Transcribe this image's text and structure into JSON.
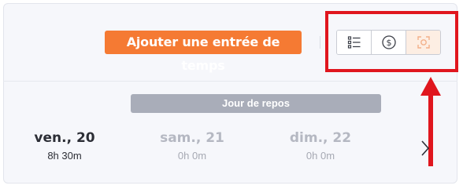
{
  "toolbar": {
    "add_time_entry_label": "Ajouter une entrée de temps",
    "view_buttons": [
      {
        "icon": "list-icon",
        "active": false
      },
      {
        "icon": "dollar-icon",
        "active": false
      },
      {
        "icon": "focus-icon",
        "active": true
      }
    ]
  },
  "banner": {
    "label": "Jour de repos"
  },
  "days": [
    {
      "name": "ven., 20",
      "hours": "8h 30m",
      "muted": false
    },
    {
      "name": "sam., 21",
      "hours": "0h 0m",
      "muted": true
    },
    {
      "name": "dim., 22",
      "hours": "0h 0m",
      "muted": true
    }
  ],
  "colors": {
    "accent": "#f57a33",
    "highlight": "#e0161e",
    "banner": "#a9adb9",
    "muted_text": "#b5b8c2"
  }
}
